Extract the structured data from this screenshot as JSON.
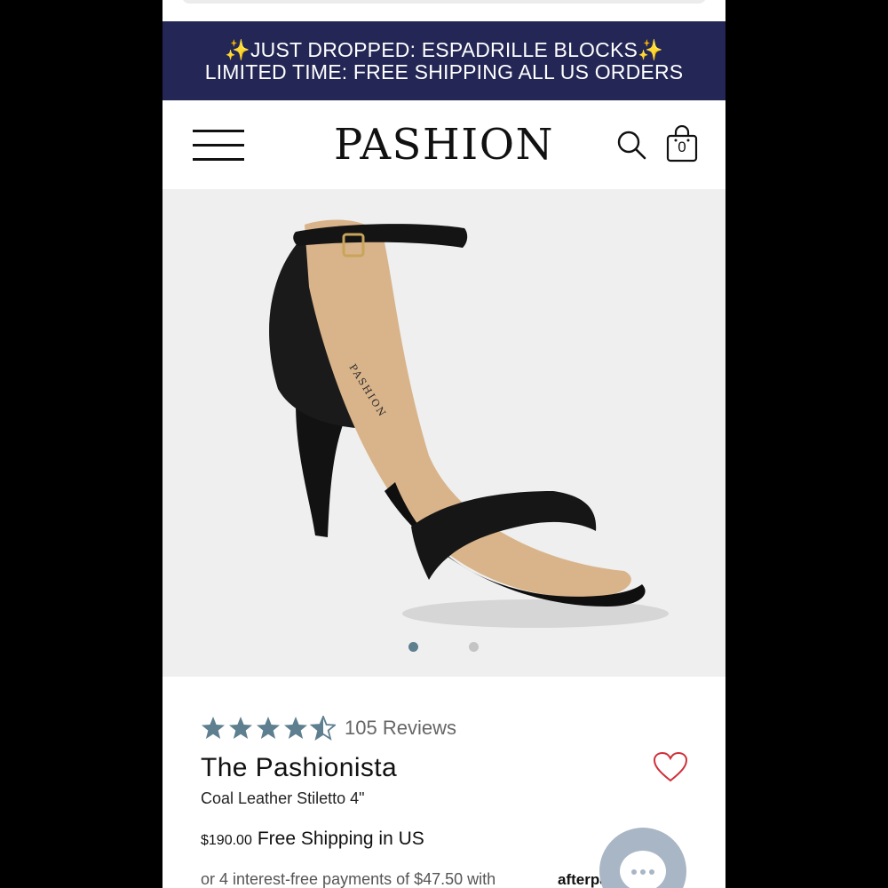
{
  "promo_banner": {
    "text": "✨JUST DROPPED: ESPADRILLE BLOCKS✨ LIMITED TIME: FREE SHIPPING ALL US ORDERS"
  },
  "header": {
    "brand": "PASHION",
    "cart_count": "0",
    "icons": [
      "menu-icon",
      "search-icon",
      "shopping-bag-icon"
    ]
  },
  "product_image": {
    "insole_brand": "PASHION",
    "carousel": {
      "total": 2,
      "active": 1
    },
    "colors": {
      "active_dot": "#5e7f8f",
      "inactive_dot": "#c4c4c4"
    }
  },
  "product": {
    "rating": 4.5,
    "reviews_label": "105 Reviews",
    "title": "The Pashionista",
    "subtitle": "Coal Leather Stiletto 4\"",
    "price": "$190.00",
    "shipping": "Free Shipping in US",
    "installments": "or 4 interest-free payments of $47.50 with",
    "afterpay": "afterpay"
  },
  "colors": {
    "banner_bg": "#242755",
    "star": "#5e7f8f",
    "heart": "#d0303a",
    "chat_bg": "#a9b6c6"
  }
}
